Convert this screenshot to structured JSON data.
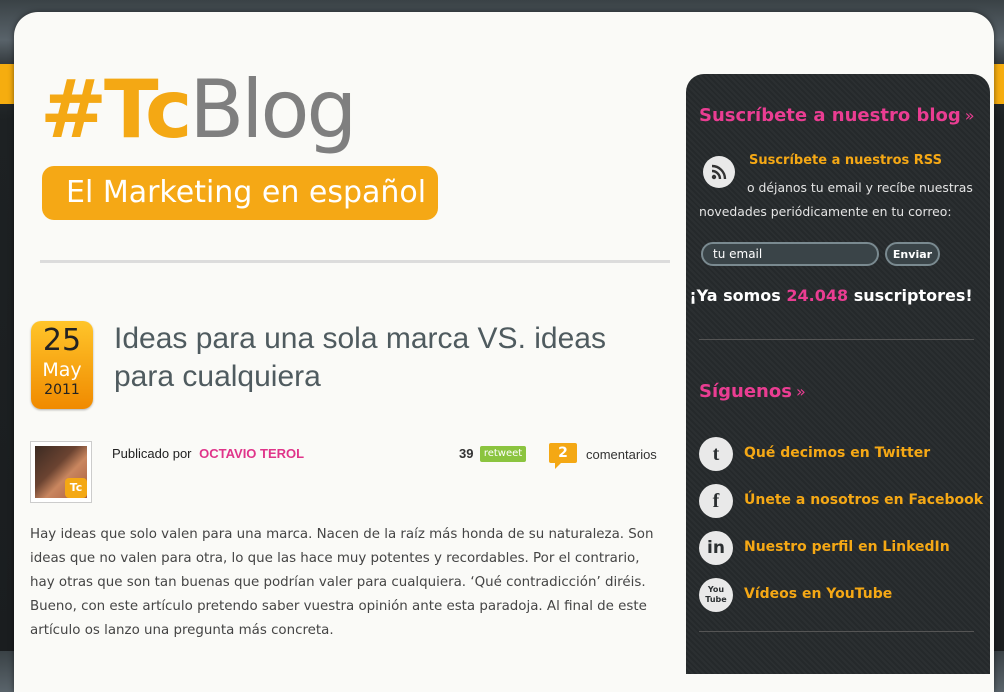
{
  "header": {
    "logo_hash": "#Tc",
    "logo_blog": "Blog",
    "tagline": "El Marketing en español"
  },
  "post": {
    "date": {
      "day": "25",
      "month": "May",
      "year": "2011"
    },
    "title": "Ideas para una sola marca VS. ideas para cualquiera",
    "byline_prefix": "Publicado por",
    "author": "OCTAVIO TEROL",
    "retweet_count": "39",
    "retweet_label": "retweet",
    "comment_count": "2",
    "comments_label": "comentarios",
    "avatar_badge": "Tc",
    "body": "Hay ideas que solo valen para una marca. Nacen de la raíz más honda de su naturaleza. Son ideas que no valen para otra, lo que las hace muy potentes y recordables. Por el contrario, hay otras que son tan buenas que podrían valer para cualquiera. ‘Qué contradicción’ diréis. Bueno, con este artículo pretendo saber vuestra opinión ante esta paradoja. Al final de este artículo os lanzo una pregunta más concreta."
  },
  "sidebar": {
    "subscribe_heading": "Suscríbete a nuestro blog",
    "rss_link": "Suscríbete a nuestros RSS",
    "rss_text": "o déjanos tu email y recíbe nuestras novedades periódicamente en tu correo:",
    "email_placeholder": "tu email",
    "send_label": "Enviar",
    "subscribers_prefix": "¡Ya somos",
    "subscribers_count": "24.048",
    "subscribers_suffix": "suscriptores!",
    "follow_heading": "Síguenos",
    "raquo": "»",
    "social": [
      {
        "label": "Qué decimos en Twitter",
        "icon": "twitter-icon",
        "glyph": "t"
      },
      {
        "label": "Únete a nosotros en Facebook",
        "icon": "facebook-icon",
        "glyph": "f"
      },
      {
        "label": "Nuestro perfil en LinkedIn",
        "icon": "linkedin-icon",
        "glyph": "in"
      },
      {
        "label": "Vídeos en YouTube",
        "icon": "youtube-icon",
        "glyph": "You Tube"
      }
    ]
  },
  "colors": {
    "accent_orange": "#f5a815",
    "accent_pink": "#ea3d92",
    "sidebar_bg": "#2b2f31"
  }
}
